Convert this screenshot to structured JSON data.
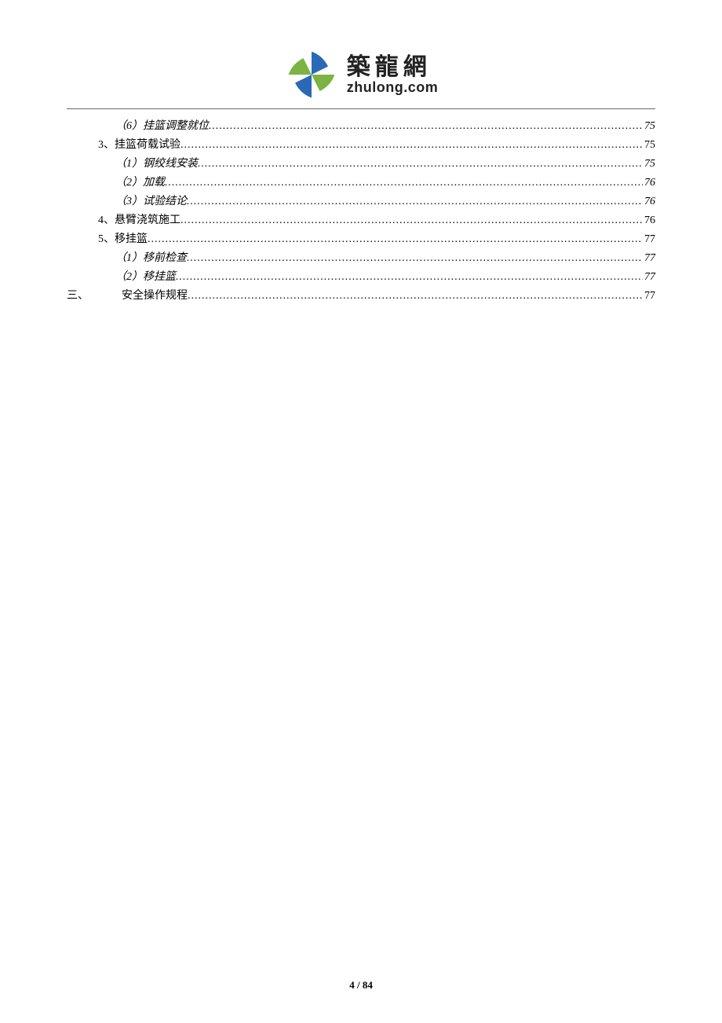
{
  "logo": {
    "cn": "築龍網",
    "en": "zhulong.com"
  },
  "toc": [
    {
      "indent": 2,
      "italic": true,
      "title": "（6）挂篮调整就位",
      "page": "75"
    },
    {
      "indent": 1,
      "italic": false,
      "title": "3、挂篮荷载试验",
      "page": "75"
    },
    {
      "indent": 2,
      "italic": true,
      "title": "（1）钢绞线安装",
      "page": "75"
    },
    {
      "indent": 2,
      "italic": true,
      "title": "（2）加载",
      "page": "76"
    },
    {
      "indent": 2,
      "italic": true,
      "title": "（3）试验结论",
      "page": "76"
    },
    {
      "indent": 1,
      "italic": false,
      "title": "4、悬臂浇筑施工",
      "page": "76"
    },
    {
      "indent": 1,
      "italic": false,
      "title": "5、移挂篮",
      "page": "77"
    },
    {
      "indent": 2,
      "italic": true,
      "title": "（1）移前检查",
      "page": "77"
    },
    {
      "indent": 2,
      "italic": true,
      "title": "（2）移挂篮",
      "page": "77"
    },
    {
      "indent": 0,
      "italic": false,
      "prefix": "三、",
      "title": "安全操作规程",
      "page": "77"
    }
  ],
  "footer": {
    "current": "4",
    "sep": " / ",
    "total": "84"
  }
}
